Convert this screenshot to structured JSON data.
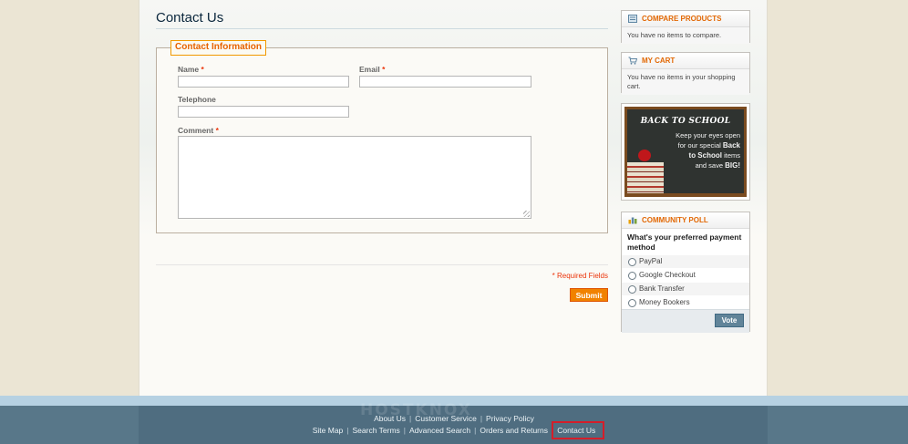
{
  "page": {
    "title": "Contact Us"
  },
  "form": {
    "legend": "Contact Information",
    "required_marker": "*",
    "name_label": "Name",
    "email_label": "Email",
    "telephone_label": "Telephone",
    "comment_label": "Comment",
    "name_value": "",
    "email_value": "",
    "telephone_value": "",
    "comment_value": "",
    "required_note": "* Required Fields",
    "submit_label": "Submit"
  },
  "sidebar": {
    "compare": {
      "title": "COMPARE PRODUCTS",
      "text": "You have no items to compare.",
      "icon": "compare-icon"
    },
    "cart": {
      "title": "MY CART",
      "text": "You have no items in your shopping cart.",
      "icon": "cart-icon"
    },
    "promo": {
      "title": "BACK TO SCHOOL",
      "line1": "Keep your eyes open",
      "line2": "for our special",
      "bold1": "Back",
      "bold2": "to School",
      "line3": "items",
      "line4": "and save",
      "bold3": "BIG!"
    },
    "poll": {
      "title": "COMMUNITY POLL",
      "icon": "poll-icon",
      "question": "What's your preferred payment method",
      "options": [
        "PayPal",
        "Google Checkout",
        "Bank Transfer",
        "Money Bookers"
      ],
      "vote_label": "Vote"
    }
  },
  "footer": {
    "watermark": "HOSTKNOX",
    "row1": [
      "About Us",
      "Customer Service",
      "Privacy Policy"
    ],
    "row2": [
      "Site Map",
      "Search Terms",
      "Advanced Search",
      "Orders and Returns",
      "Contact Us"
    ],
    "separator": "|",
    "colors": {
      "band": "#587789",
      "highlight": "#d41e2a"
    }
  },
  "colors": {
    "accent": "#e76200",
    "submit": "#f18200",
    "vote": "#618499"
  }
}
